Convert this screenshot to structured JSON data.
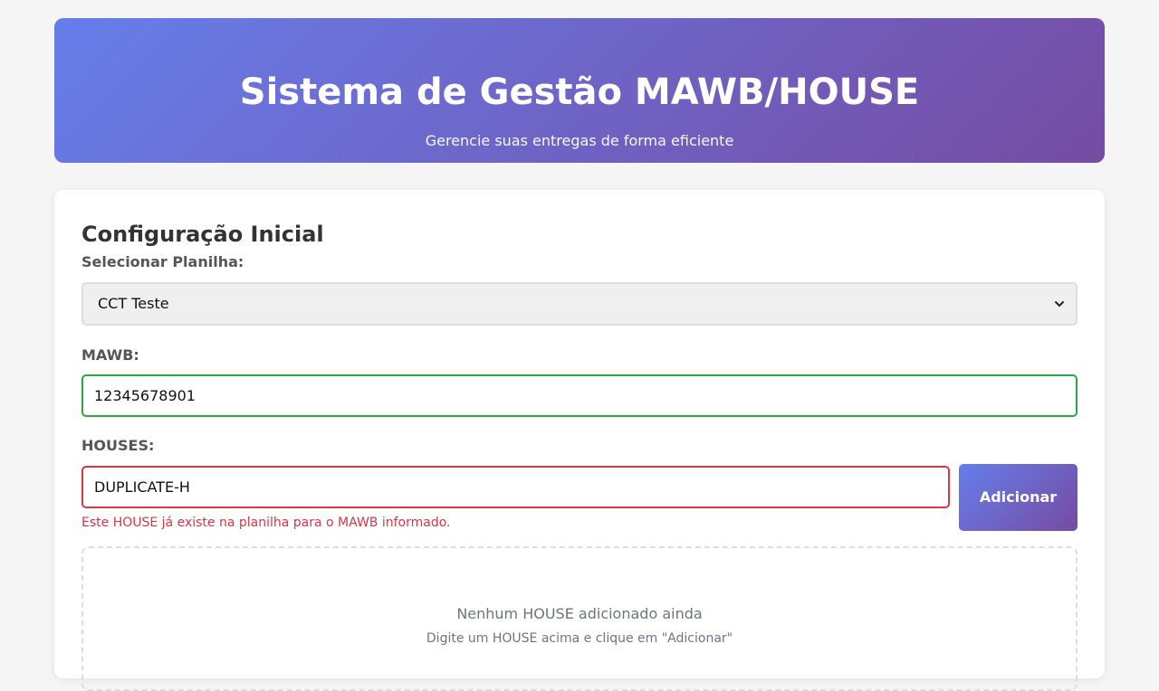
{
  "header": {
    "title": "Sistema de Gestão MAWB/HOUSE",
    "subtitle": "Gerencie suas entregas de forma eficiente"
  },
  "config": {
    "section_title": "Configuração Inicial",
    "spreadsheet_label": "Selecionar Planilha:",
    "spreadsheet_selected": "CCT Teste",
    "mawb_label": "MAWB:",
    "mawb_value": "12345678901",
    "houses_label": "HOUSES:",
    "house_value": "DUPLICATE-H",
    "house_error": "Este HOUSE já existe na planilha para o MAWB informado.",
    "add_button_label": "Adicionar",
    "empty_title": "Nenhum HOUSE adicionado ainda",
    "empty_hint": "Digite um HOUSE acima e clique em \"Adicionar\""
  },
  "icons": {
    "select_arrow": "chevron-down-icon"
  },
  "colors": {
    "gradient_start": "#667eea",
    "gradient_end": "#764ba2",
    "valid": "#28a745",
    "error": "#dc3545"
  }
}
